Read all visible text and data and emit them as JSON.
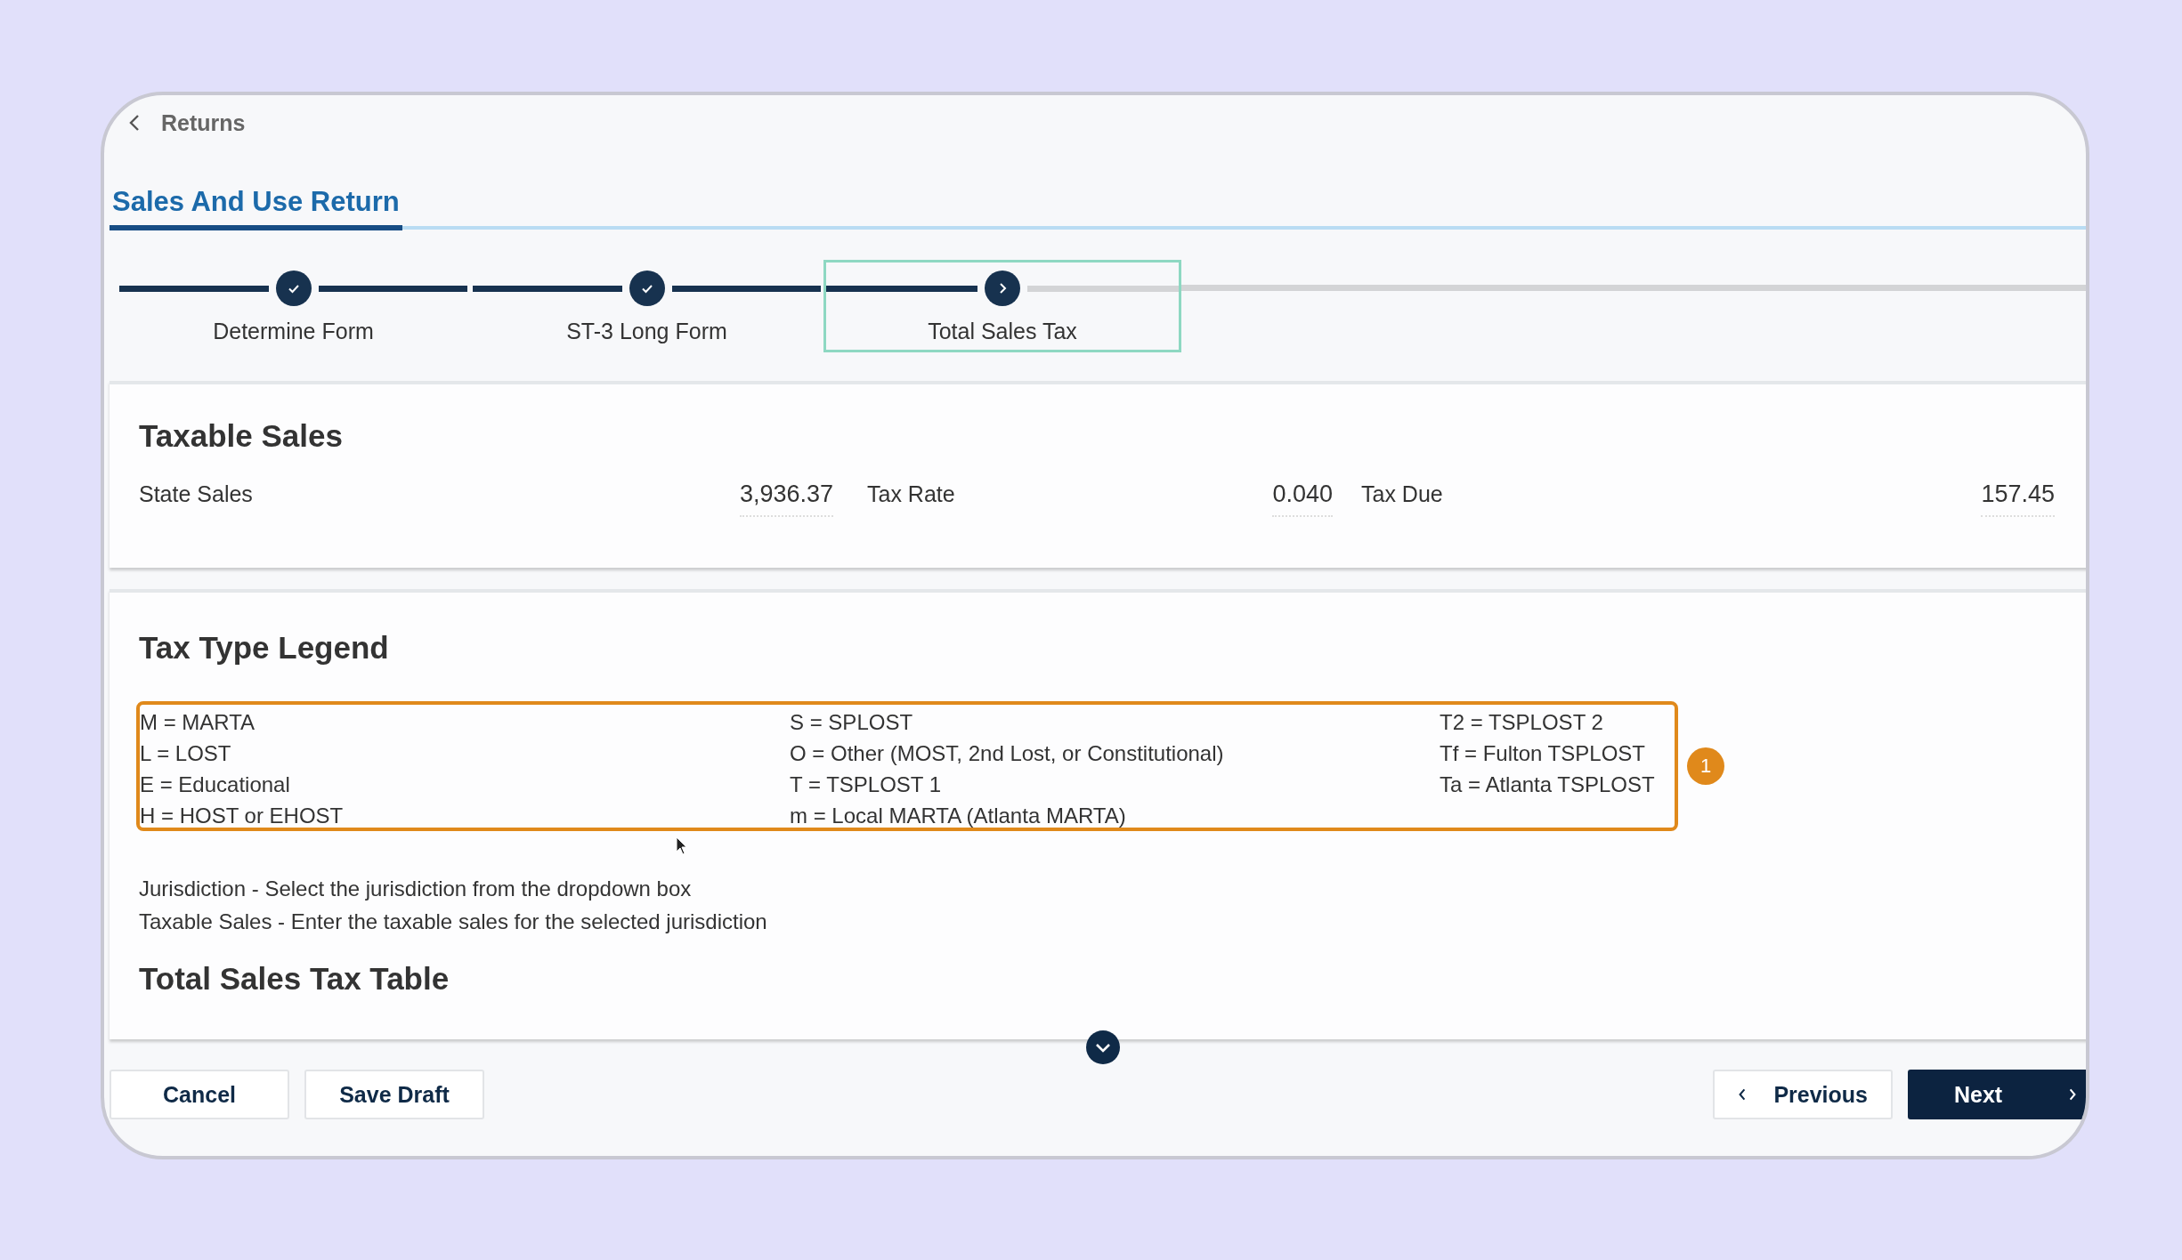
{
  "back_link": {
    "label": "Returns"
  },
  "page_tab": {
    "label": "Sales And Use Return",
    "selected": true
  },
  "steps": [
    {
      "label": "Determine Form",
      "completed": true,
      "selected": false
    },
    {
      "label": "ST-3 Long Form",
      "completed": true,
      "selected": false
    },
    {
      "label": "Total Sales Tax",
      "completed": false,
      "selected": true
    }
  ],
  "taxable_sales": {
    "title": "Taxable Sales",
    "fields": [
      {
        "label": "State Sales",
        "value": "3,936.37"
      },
      {
        "label": "Tax Rate",
        "value": "0.040"
      },
      {
        "label": "Tax Due",
        "value": "157.45"
      }
    ]
  },
  "legend": {
    "title": "Tax Type Legend",
    "callout": "1",
    "columns": [
      [
        "M = MARTA",
        "L = LOST",
        "E = Educational",
        "H = HOST or EHOST"
      ],
      [
        "S = SPLOST",
        "O = Other (MOST, 2nd Lost, or Constitutional)",
        "T = TSPLOST 1",
        "m = Local MARTA (Atlanta MARTA)"
      ],
      [
        "T2 = TSPLOST 2",
        "Tf = Fulton TSPLOST",
        "Ta = Atlanta TSPLOST"
      ]
    ]
  },
  "notes": [
    "Jurisdiction - Select the jurisdiction from the dropdown box",
    "Taxable Sales - Enter the taxable sales for the selected jurisdiction"
  ],
  "table_title": "Total Sales Tax Table",
  "footer": {
    "left_buttons": [
      "Cancel",
      "Save Draft"
    ],
    "previous": "Previous",
    "next": "Next"
  }
}
